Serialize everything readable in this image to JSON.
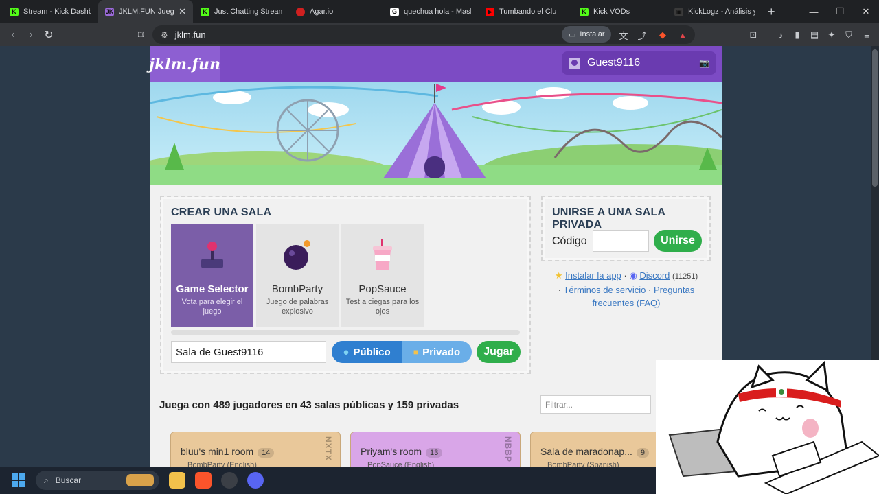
{
  "browser": {
    "tabs": [
      {
        "label": "Stream - Kick Dashboa",
        "color": "#53fc18",
        "glyph": "K",
        "active": false
      },
      {
        "label": "JKLM.FUN Juegos",
        "color": "#9b6ad9",
        "glyph": "JK",
        "active": true
      },
      {
        "label": "Just Chatting Streamin",
        "color": "#53fc18",
        "glyph": "K",
        "active": false
      },
      {
        "label": "Agar.io",
        "color": "#d02020",
        "glyph": "",
        "active": false
      },
      {
        "label": "quechua hola - Mask",
        "color": "#ffffff",
        "glyph": "G",
        "active": false
      },
      {
        "label": "Tumbando el Clu",
        "color": "#ff0000",
        "glyph": "▶",
        "active": false
      },
      {
        "label": "Kick VODs",
        "color": "#53fc18",
        "glyph": "K",
        "active": false
      },
      {
        "label": "KickLogz - Análisis y E",
        "color": "#3a3a3a",
        "glyph": "▣",
        "active": false
      }
    ],
    "url": "jklm.fun",
    "install_label": "Instalar"
  },
  "header": {
    "logo": "jklm.fun",
    "username": "Guest9116"
  },
  "create": {
    "title": "CREAR UNA SALA",
    "games": [
      {
        "name": "Game Selector",
        "desc": "Vota para elegir el juego",
        "icon": "joystick-icon",
        "selected": true
      },
      {
        "name": "BombParty",
        "desc": "Juego de palabras explosivo",
        "icon": "bomb-icon",
        "selected": false
      },
      {
        "name": "PopSauce",
        "desc": "Test a ciegas para los ojos",
        "icon": "drink-cup-icon",
        "selected": false
      }
    ],
    "room_name": "Sala de Guest9116",
    "public_label": "Público",
    "private_label": "Privado",
    "play_label": "Jugar"
  },
  "join": {
    "title": "UNIRSE A UNA SALA PRIVADA",
    "code_label": "Código",
    "join_label": "Unirse"
  },
  "links": {
    "install_app": "Instalar la app",
    "discord": "Discord",
    "discord_count": "(11251)",
    "terms": "Términos de servicio",
    "faq": "Preguntas frecuentes (FAQ)"
  },
  "lobby": {
    "title": "Juega con 489 jugadores en 43 salas públicas y 159 privadas",
    "filter_placeholder": "Filtrar...",
    "rooms": [
      {
        "name": "bluu's min1 room",
        "count": "14",
        "code": "NXTX",
        "sub": "BombParty (English)",
        "color": "#e9c89a"
      },
      {
        "name": "Priyam's room",
        "count": "13",
        "code": "NBBP",
        "sub": "PopSauce (English)",
        "color": "#d9a6e8"
      },
      {
        "name": "Sala de maradonap...",
        "count": "9",
        "code": "",
        "sub": "BombParty (Spanish)",
        "color": "#e9c89a"
      }
    ]
  },
  "taskbar": {
    "search_label": "Buscar"
  }
}
